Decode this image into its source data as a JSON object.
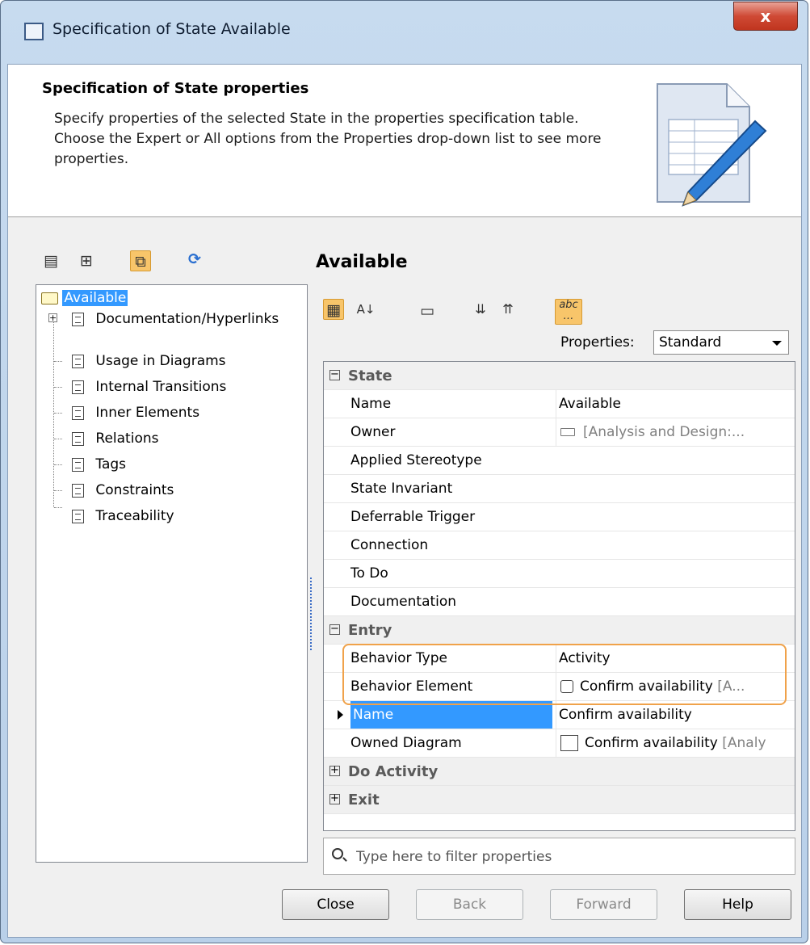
{
  "window": {
    "title": "Specification of State Available",
    "close_glyph": "x"
  },
  "header": {
    "title": "Specification of State properties",
    "description": "Specify properties of the selected State in the properties specification table. Choose the Expert or All options from the Properties drop-down list to see more properties."
  },
  "tree": {
    "root": "Available",
    "items": [
      "Documentation/Hyperlinks",
      "Usage in Diagrams",
      "Internal Transitions",
      "Inner Elements",
      "Relations",
      "Tags",
      "Constraints",
      "Traceability"
    ]
  },
  "panel": {
    "title": "Available",
    "properties_label": "Properties:",
    "properties_value": "Standard"
  },
  "grid": {
    "state_cat": "State",
    "state_rows": [
      {
        "name": "Name",
        "value": "Available"
      },
      {
        "name": "Owner",
        "value": "[Analysis and Design:..."
      },
      {
        "name": "Applied Stereotype",
        "value": ""
      },
      {
        "name": "State Invariant",
        "value": ""
      },
      {
        "name": "Deferrable Trigger",
        "value": ""
      },
      {
        "name": "Connection",
        "value": ""
      },
      {
        "name": "To Do",
        "value": ""
      },
      {
        "name": "Documentation",
        "value": ""
      }
    ],
    "entry_cat": "Entry",
    "entry_rows": [
      {
        "name": "Behavior Type",
        "value": "Activity"
      },
      {
        "name": "Behavior Element",
        "value": "Confirm availability",
        "suffix": "[A..."
      },
      {
        "name": "Name",
        "value": "Confirm availability"
      },
      {
        "name": "Owned Diagram",
        "value": "Confirm availability",
        "suffix": "[Analy"
      }
    ],
    "do_cat": "Do Activity",
    "exit_cat": "Exit"
  },
  "filter": {
    "placeholder": "Type here to filter properties"
  },
  "buttons": {
    "close": "Close",
    "back": "Back",
    "forward": "Forward",
    "help": "Help"
  },
  "colors": {
    "selection": "#3399ff",
    "highlight_box": "#f0a24a",
    "active_tool": "#f8c56a"
  }
}
